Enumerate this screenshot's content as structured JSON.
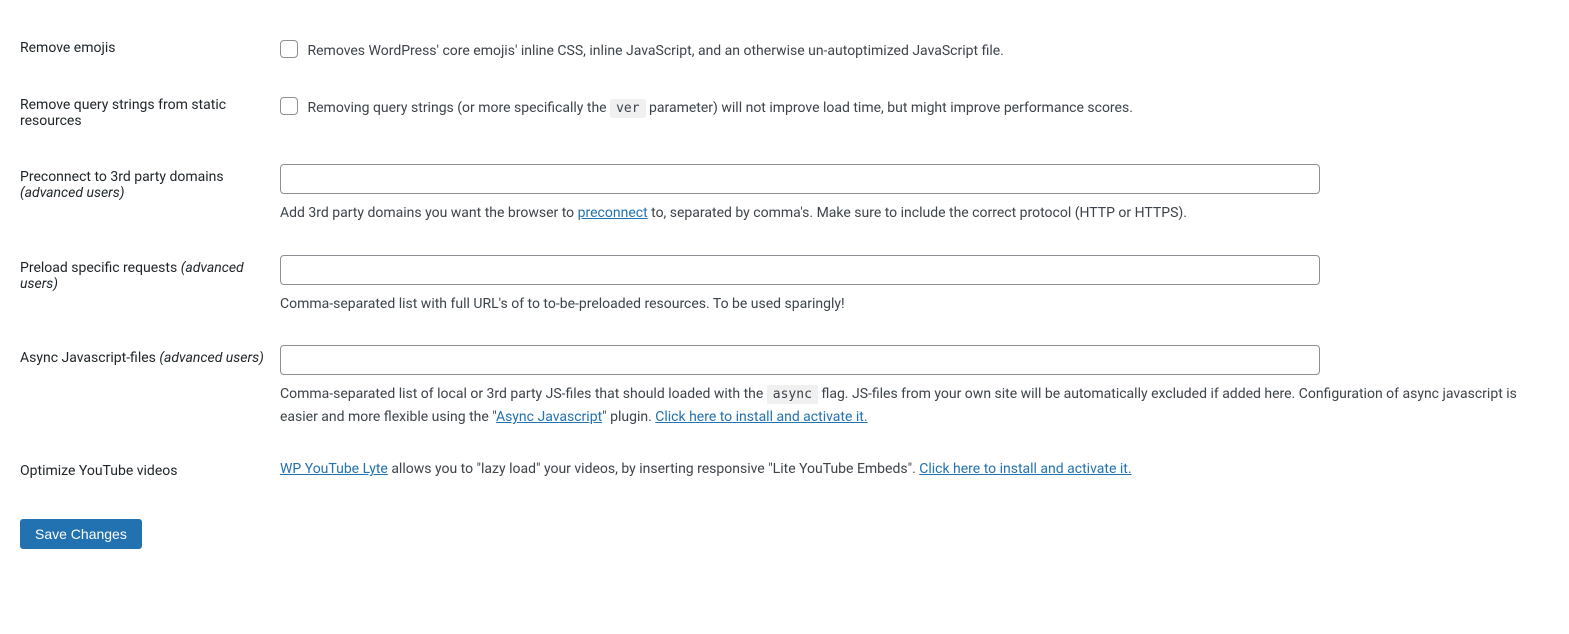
{
  "rows": {
    "remove_emojis": {
      "label": "Remove emojis",
      "checked": false,
      "desc": "Removes WordPress' core emojis' inline CSS, inline JavaScript, and an otherwise un-autoptimized JavaScript file."
    },
    "remove_query_strings": {
      "label": "Remove query strings from static resources",
      "checked": false,
      "desc_before": "Removing query strings (or more specifically the ",
      "code": "ver",
      "desc_after": " parameter) will not improve load time, but might improve performance scores."
    },
    "preconnect": {
      "label_main": "Preconnect to 3rd party domains ",
      "label_note": "(advanced users)",
      "value": "",
      "desc_before": "Add 3rd party domains you want the browser to ",
      "link_text": "preconnect",
      "desc_after": " to, separated by comma's. Make sure to include the correct protocol (HTTP or HTTPS)."
    },
    "preload": {
      "label_main": "Preload specific requests ",
      "label_note": "(advanced users)",
      "value": "",
      "desc": "Comma-separated list with full URL's of to to-be-preloaded resources. To be used sparingly!"
    },
    "async_js": {
      "label_main": "Async Javascript-files ",
      "label_note": "(advanced users)",
      "value": "",
      "desc_before": "Comma-separated list of local or 3rd party JS-files that should loaded with the ",
      "code": "async",
      "desc_mid": " flag. JS-files from your own site will be automatically excluded if added here. Configuration of async javascript is easier and more flexible using the \"",
      "link1_text": "Async Javascript",
      "desc_after_link1": "\" plugin. ",
      "link2_text": "Click here to install and activate it."
    },
    "youtube": {
      "label": "Optimize YouTube videos",
      "link1_text": "WP YouTube Lyte",
      "desc_mid": " allows you to \"lazy load\" your videos, by inserting responsive \"Lite YouTube Embeds\". ",
      "link2_text": "Click here to install and activate it."
    }
  },
  "save_button": "Save Changes"
}
